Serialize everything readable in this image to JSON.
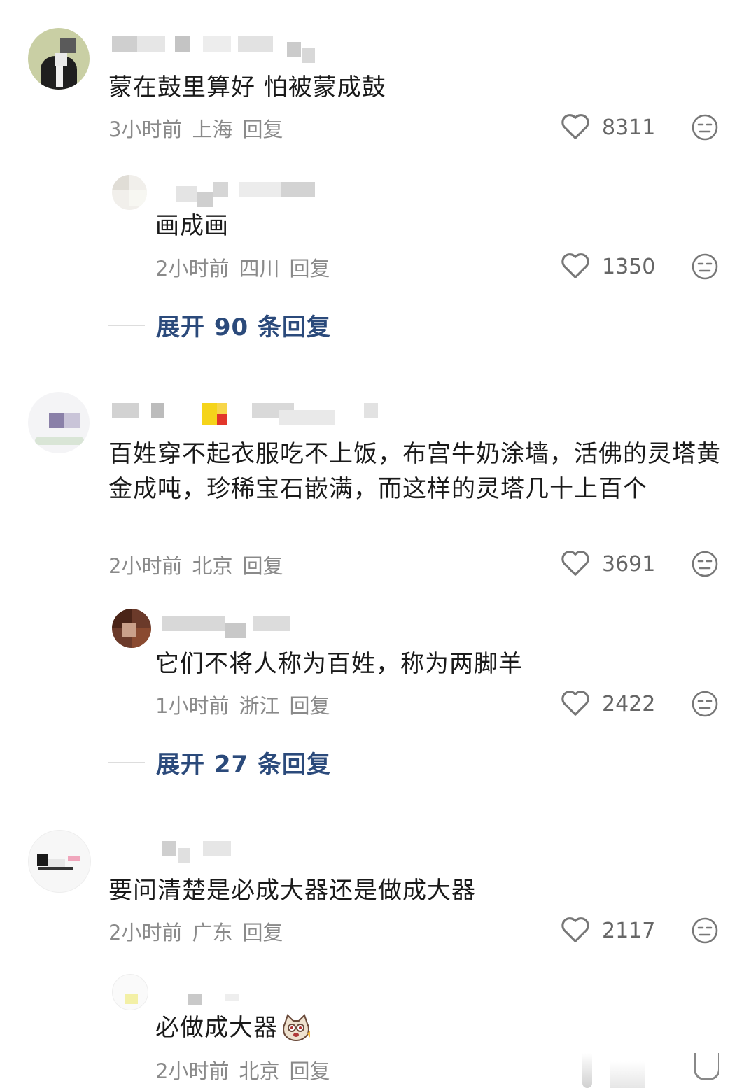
{
  "comments": [
    {
      "text": "蒙在鼓里算好 怕被蒙成鼓",
      "time": "3小时前",
      "location": "上海",
      "reply": "回复",
      "likes": "8311",
      "replies": [
        {
          "text": "画成画",
          "time": "2小时前",
          "location": "四川",
          "reply": "回复",
          "likes": "1350"
        }
      ],
      "expand": "展开 90 条回复"
    },
    {
      "text": "百姓穿不起衣服吃不上饭，布宫牛奶涂墙，活佛的灵塔黄金成吨，珍稀宝石嵌满，而这样的灵塔几十上百个",
      "time": "2小时前",
      "location": "北京",
      "reply": "回复",
      "likes": "3691",
      "replies": [
        {
          "text": "它们不将人称为百姓，称为两脚羊",
          "time": "1小时前",
          "location": "浙江",
          "reply": "回复",
          "likes": "2422"
        }
      ],
      "expand": "展开 27 条回复"
    },
    {
      "text": "要问清楚是必成大器还是做成大器",
      "time": "2小时前",
      "location": "广东",
      "reply": "回复",
      "likes": "2117",
      "replies": [
        {
          "text": "必做成大器",
          "emoji": "cat-sticker-icon",
          "time": "2小时前",
          "location": "北京",
          "reply": "回复"
        }
      ]
    }
  ],
  "icons": {
    "like": "heart-outline-icon",
    "dislike": "meh-face-icon"
  },
  "colors": {
    "text": "#1a1a1a",
    "meta": "#8a8a8a",
    "expand": "#2b4a7b",
    "icon": "#777777"
  }
}
